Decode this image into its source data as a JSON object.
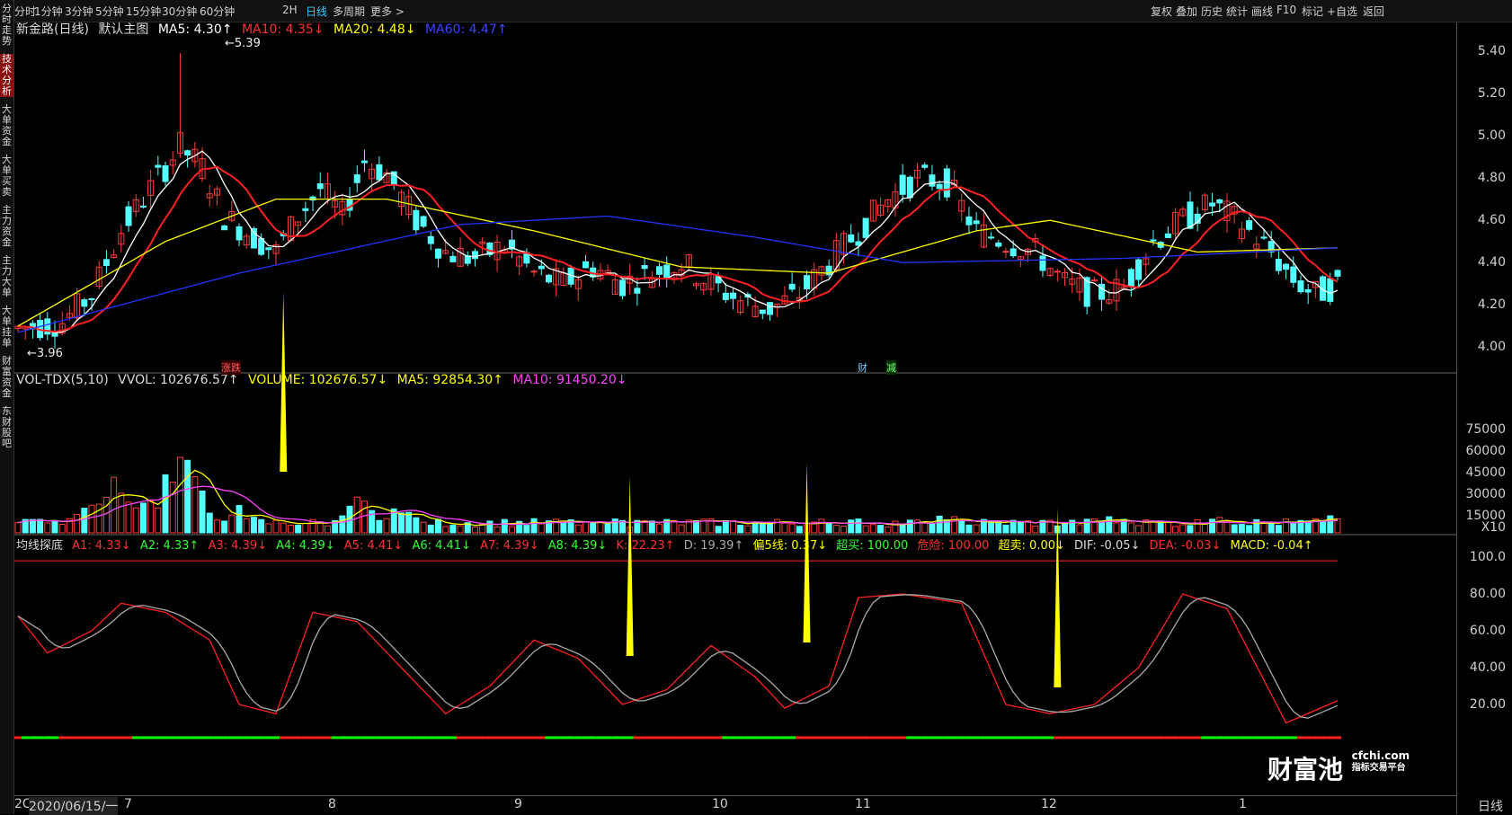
{
  "topbar": {
    "left_tabs": [
      "分时",
      "1分钟",
      "3分钟",
      "5分钟",
      "15分钟",
      "30分钟",
      "60分钟",
      "2H",
      "日线",
      "多周期",
      "更多 >"
    ],
    "active_tab": "日线",
    "right_buttons": [
      "复权",
      "叠加",
      "历史",
      "统计",
      "画线",
      "F10",
      "标记",
      "+自选",
      "返回"
    ]
  },
  "sidebar": {
    "tabs": [
      "分时走势",
      "技术分析",
      "大单资金",
      "大单买卖",
      "主力资金",
      "主力大单",
      "大单挂单",
      "财富资金",
      "东财股吧"
    ],
    "active": "技术分析"
  },
  "main_panel": {
    "title": "新金路(日线)",
    "indicator_name": "默认主图",
    "ma5": "MA5: 4.30↑",
    "ma10": "MA10: 4.35↓",
    "ma20": "MA20: 4.48↓",
    "ma60": "MA60: 4.47↑",
    "high_label": "5.39",
    "low_label": "3.96",
    "marker_zd": "涨跌",
    "marker_cai": "财",
    "marker_jian": "减",
    "yticks": [
      "5.40",
      "5.20",
      "5.00",
      "4.80",
      "4.60",
      "4.40",
      "4.20",
      "4.00"
    ]
  },
  "vol_panel": {
    "name": "VOL-TDX(5,10)",
    "vvol": "VVOL: 102676.57↑",
    "volume": "VOLUME: 102676.57↓",
    "ma5": "MA5: 92854.30↑",
    "ma10": "MA10: 91450.20↓",
    "yticks": [
      "75000",
      "60000",
      "45000",
      "30000",
      "15000"
    ],
    "unit": "X10"
  },
  "ind_panel": {
    "name": "均线探底",
    "a1": "A1: 4.33↓",
    "a2": "A2: 4.33↑",
    "a3": "A3: 4.39↓",
    "a4": "A4: 4.39↓",
    "a5": "A5: 4.41↓",
    "a6": "A6: 4.41↓",
    "a7": "A7: 4.39↓",
    "a8": "A8: 4.39↓",
    "k": "K: 22.23↑",
    "d": "D: 19.39↑",
    "p5": "偏5线: 0.37↓",
    "cm": "超买: 100.00",
    "wx": "危险: 100.00",
    "cmai": "超卖: 0.00↓",
    "dif": "DIF: -0.05↓",
    "dea": "DEA: -0.03↓",
    "macd": "MACD: -0.04↑",
    "yticks": [
      "100.0",
      "80.00",
      "60.00",
      "40.00",
      "20.00"
    ]
  },
  "x_axis": {
    "date_label": "2020/06/15/一",
    "prefix": "2C",
    "months": [
      "7",
      "8",
      "9",
      "10",
      "11",
      "12",
      "1"
    ],
    "period": "日线"
  },
  "watermark": {
    "text": "财富池",
    "url": "cfchi.com",
    "sub": "指标交易平台"
  },
  "colors": {
    "up": "#ff3b3b",
    "down": "#54ffff",
    "ma5": "#ffffff",
    "ma10": "#ff2020",
    "ma20": "#ffff00",
    "ma60": "#2233ff",
    "arrow": "#ffff00",
    "oversold": "#00ff00"
  },
  "chart_data": [
    {
      "type": "candlestick",
      "title": "新金路(日线)",
      "ylim": [
        3.9,
        5.45
      ],
      "trend_points": [
        [
          0,
          4.09
        ],
        [
          6,
          4.12
        ],
        [
          10,
          4.25
        ],
        [
          14,
          4.55
        ],
        [
          18,
          4.75
        ],
        [
          22,
          4.95
        ],
        [
          25,
          4.85
        ],
        [
          28,
          4.62
        ],
        [
          32,
          4.52
        ],
        [
          35,
          4.45
        ],
        [
          38,
          4.62
        ],
        [
          41,
          4.75
        ],
        [
          44,
          4.62
        ],
        [
          47,
          4.88
        ],
        [
          50,
          4.82
        ],
        [
          54,
          4.6
        ],
        [
          58,
          4.45
        ],
        [
          62,
          4.42
        ],
        [
          66,
          4.48
        ],
        [
          70,
          4.35
        ],
        [
          74,
          4.3
        ],
        [
          78,
          4.38
        ],
        [
          82,
          4.3
        ],
        [
          86,
          4.35
        ],
        [
          90,
          4.4
        ],
        [
          94,
          4.3
        ],
        [
          98,
          4.22
        ],
        [
          102,
          4.18
        ],
        [
          106,
          4.25
        ],
        [
          110,
          4.4
        ],
        [
          114,
          4.55
        ],
        [
          118,
          4.7
        ],
        [
          122,
          4.8
        ],
        [
          126,
          4.78
        ],
        [
          130,
          4.55
        ],
        [
          134,
          4.5
        ],
        [
          138,
          4.45
        ],
        [
          142,
          4.3
        ],
        [
          146,
          4.25
        ],
        [
          150,
          4.28
        ],
        [
          154,
          4.5
        ],
        [
          158,
          4.6
        ],
        [
          162,
          4.68
        ],
        [
          166,
          4.58
        ],
        [
          170,
          4.45
        ],
        [
          173,
          4.32
        ],
        [
          176,
          4.25
        ],
        [
          179,
          4.3
        ]
      ],
      "ma60_points": [
        [
          0,
          4.07
        ],
        [
          30,
          4.35
        ],
        [
          60,
          4.58
        ],
        [
          80,
          4.62
        ],
        [
          100,
          4.52
        ],
        [
          120,
          4.4
        ],
        [
          150,
          4.42
        ],
        [
          179,
          4.47
        ]
      ],
      "ma20_points": [
        [
          0,
          4.1
        ],
        [
          20,
          4.5
        ],
        [
          35,
          4.7
        ],
        [
          50,
          4.7
        ],
        [
          70,
          4.55
        ],
        [
          90,
          4.38
        ],
        [
          110,
          4.35
        ],
        [
          130,
          4.55
        ],
        [
          140,
          4.6
        ],
        [
          160,
          4.45
        ],
        [
          179,
          4.47
        ]
      ],
      "high": 5.39,
      "low": 3.96
    },
    {
      "type": "bar",
      "title": "VOL-TDX(5,10)",
      "unit": "X10",
      "ylim": [
        0,
        80000
      ],
      "spikes": [
        [
          2,
          15000
        ],
        [
          9,
          25000
        ],
        [
          13,
          40000
        ],
        [
          17,
          30000
        ],
        [
          22,
          75000
        ],
        [
          24,
          40000
        ],
        [
          30,
          20000
        ],
        [
          46,
          30000
        ],
        [
          52,
          22000
        ],
        [
          80,
          10000
        ],
        [
          110,
          8000
        ],
        [
          126,
          15000
        ],
        [
          148,
          12000
        ],
        [
          163,
          15000
        ],
        [
          178,
          15000
        ]
      ]
    },
    {
      "type": "line",
      "title": "均线探底",
      "ylim": [
        0,
        100
      ],
      "k_points": [
        [
          0,
          68
        ],
        [
          4,
          48
        ],
        [
          10,
          60
        ],
        [
          14,
          75
        ],
        [
          20,
          70
        ],
        [
          26,
          55
        ],
        [
          30,
          20
        ],
        [
          35,
          15
        ],
        [
          40,
          70
        ],
        [
          46,
          65
        ],
        [
          52,
          40
        ],
        [
          58,
          15
        ],
        [
          64,
          30
        ],
        [
          70,
          55
        ],
        [
          76,
          45
        ],
        [
          82,
          20
        ],
        [
          88,
          28
        ],
        [
          94,
          52
        ],
        [
          100,
          35
        ],
        [
          104,
          18
        ],
        [
          110,
          30
        ],
        [
          114,
          78
        ],
        [
          120,
          80
        ],
        [
          128,
          75
        ],
        [
          134,
          20
        ],
        [
          140,
          15
        ],
        [
          146,
          20
        ],
        [
          152,
          40
        ],
        [
          158,
          80
        ],
        [
          164,
          72
        ],
        [
          172,
          10
        ],
        [
          179,
          22
        ]
      ]
    }
  ]
}
